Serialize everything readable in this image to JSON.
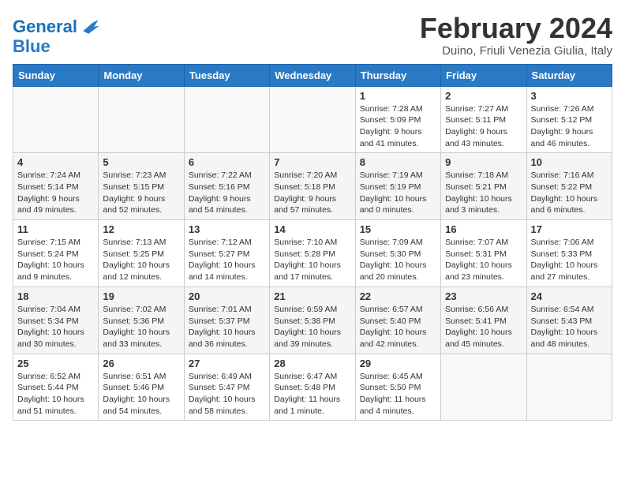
{
  "logo": {
    "line1": "General",
    "line2": "Blue"
  },
  "calendar": {
    "title": "February 2024",
    "subtitle": "Duino, Friuli Venezia Giulia, Italy",
    "headers": [
      "Sunday",
      "Monday",
      "Tuesday",
      "Wednesday",
      "Thursday",
      "Friday",
      "Saturday"
    ],
    "weeks": [
      [
        {
          "day": "",
          "detail": ""
        },
        {
          "day": "",
          "detail": ""
        },
        {
          "day": "",
          "detail": ""
        },
        {
          "day": "",
          "detail": ""
        },
        {
          "day": "1",
          "detail": "Sunrise: 7:28 AM\nSunset: 5:09 PM\nDaylight: 9 hours\nand 41 minutes."
        },
        {
          "day": "2",
          "detail": "Sunrise: 7:27 AM\nSunset: 5:11 PM\nDaylight: 9 hours\nand 43 minutes."
        },
        {
          "day": "3",
          "detail": "Sunrise: 7:26 AM\nSunset: 5:12 PM\nDaylight: 9 hours\nand 46 minutes."
        }
      ],
      [
        {
          "day": "4",
          "detail": "Sunrise: 7:24 AM\nSunset: 5:14 PM\nDaylight: 9 hours\nand 49 minutes."
        },
        {
          "day": "5",
          "detail": "Sunrise: 7:23 AM\nSunset: 5:15 PM\nDaylight: 9 hours\nand 52 minutes."
        },
        {
          "day": "6",
          "detail": "Sunrise: 7:22 AM\nSunset: 5:16 PM\nDaylight: 9 hours\nand 54 minutes."
        },
        {
          "day": "7",
          "detail": "Sunrise: 7:20 AM\nSunset: 5:18 PM\nDaylight: 9 hours\nand 57 minutes."
        },
        {
          "day": "8",
          "detail": "Sunrise: 7:19 AM\nSunset: 5:19 PM\nDaylight: 10 hours\nand 0 minutes."
        },
        {
          "day": "9",
          "detail": "Sunrise: 7:18 AM\nSunset: 5:21 PM\nDaylight: 10 hours\nand 3 minutes."
        },
        {
          "day": "10",
          "detail": "Sunrise: 7:16 AM\nSunset: 5:22 PM\nDaylight: 10 hours\nand 6 minutes."
        }
      ],
      [
        {
          "day": "11",
          "detail": "Sunrise: 7:15 AM\nSunset: 5:24 PM\nDaylight: 10 hours\nand 9 minutes."
        },
        {
          "day": "12",
          "detail": "Sunrise: 7:13 AM\nSunset: 5:25 PM\nDaylight: 10 hours\nand 12 minutes."
        },
        {
          "day": "13",
          "detail": "Sunrise: 7:12 AM\nSunset: 5:27 PM\nDaylight: 10 hours\nand 14 minutes."
        },
        {
          "day": "14",
          "detail": "Sunrise: 7:10 AM\nSunset: 5:28 PM\nDaylight: 10 hours\nand 17 minutes."
        },
        {
          "day": "15",
          "detail": "Sunrise: 7:09 AM\nSunset: 5:30 PM\nDaylight: 10 hours\nand 20 minutes."
        },
        {
          "day": "16",
          "detail": "Sunrise: 7:07 AM\nSunset: 5:31 PM\nDaylight: 10 hours\nand 23 minutes."
        },
        {
          "day": "17",
          "detail": "Sunrise: 7:06 AM\nSunset: 5:33 PM\nDaylight: 10 hours\nand 27 minutes."
        }
      ],
      [
        {
          "day": "18",
          "detail": "Sunrise: 7:04 AM\nSunset: 5:34 PM\nDaylight: 10 hours\nand 30 minutes."
        },
        {
          "day": "19",
          "detail": "Sunrise: 7:02 AM\nSunset: 5:36 PM\nDaylight: 10 hours\nand 33 minutes."
        },
        {
          "day": "20",
          "detail": "Sunrise: 7:01 AM\nSunset: 5:37 PM\nDaylight: 10 hours\nand 36 minutes."
        },
        {
          "day": "21",
          "detail": "Sunrise: 6:59 AM\nSunset: 5:38 PM\nDaylight: 10 hours\nand 39 minutes."
        },
        {
          "day": "22",
          "detail": "Sunrise: 6:57 AM\nSunset: 5:40 PM\nDaylight: 10 hours\nand 42 minutes."
        },
        {
          "day": "23",
          "detail": "Sunrise: 6:56 AM\nSunset: 5:41 PM\nDaylight: 10 hours\nand 45 minutes."
        },
        {
          "day": "24",
          "detail": "Sunrise: 6:54 AM\nSunset: 5:43 PM\nDaylight: 10 hours\nand 48 minutes."
        }
      ],
      [
        {
          "day": "25",
          "detail": "Sunrise: 6:52 AM\nSunset: 5:44 PM\nDaylight: 10 hours\nand 51 minutes."
        },
        {
          "day": "26",
          "detail": "Sunrise: 6:51 AM\nSunset: 5:46 PM\nDaylight: 10 hours\nand 54 minutes."
        },
        {
          "day": "27",
          "detail": "Sunrise: 6:49 AM\nSunset: 5:47 PM\nDaylight: 10 hours\nand 58 minutes."
        },
        {
          "day": "28",
          "detail": "Sunrise: 6:47 AM\nSunset: 5:48 PM\nDaylight: 11 hours\nand 1 minute."
        },
        {
          "day": "29",
          "detail": "Sunrise: 6:45 AM\nSunset: 5:50 PM\nDaylight: 11 hours\nand 4 minutes."
        },
        {
          "day": "",
          "detail": ""
        },
        {
          "day": "",
          "detail": ""
        }
      ]
    ]
  }
}
